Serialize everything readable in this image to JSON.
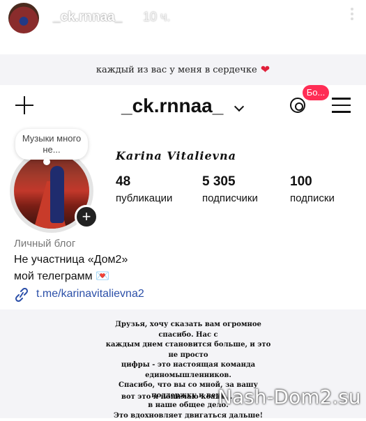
{
  "story": {
    "username": "_ck.rnnaa_",
    "time": "10 ч."
  },
  "caption": {
    "text": "каждый из вас у меня в сердечке",
    "heart": "❤"
  },
  "profile": {
    "username": "_ck.rnnaa_",
    "threads_badge": "Бо...",
    "note": "Музыки много не...",
    "display_name": "Karina Vitalievna",
    "stats": [
      {
        "value": "48",
        "label": "публикации"
      },
      {
        "value": "5 305",
        "label": "подписчики"
      },
      {
        "value": "100",
        "label": "подписки"
      }
    ],
    "bio": {
      "category": "Личный блог",
      "line1": "Не участница «Дом2»",
      "line2": "мой телеграмм 💌",
      "link": "t.me/karinavitalievna2"
    }
  },
  "message": {
    "lines": [
      "Друзья, хочу сказать вам огромное спасибо. Нас с",
      "каждым днем становится больше, и это не просто",
      "цифры - это настоящая команда единомышленников.",
      "Спасибо, что вы со мной, за вашу поддержку и веру",
      "в наше общее дело.",
      "Это вдохновляет двигаться дальше!"
    ],
    "last": "вот это я понимаю коали..."
  },
  "watermark": "Nash-Dom2.su",
  "icons": {
    "plus": "plus-icon",
    "chevron": "chevron-down-icon",
    "threads": "threads-icon",
    "menu": "menu-icon",
    "link": "link-icon",
    "more": "more-vertical-icon"
  },
  "colors": {
    "badge": "#ff2d55",
    "heart": "#e0203a",
    "link": "#2b4fa8"
  }
}
